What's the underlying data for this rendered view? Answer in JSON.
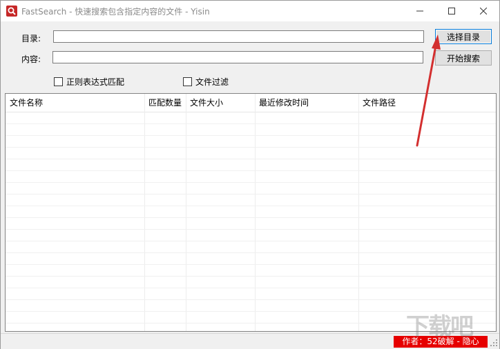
{
  "window": {
    "title": "FastSearch - 快速搜索包含指定内容的文件 - Yisin",
    "app_icon": "search-icon"
  },
  "form": {
    "directory_label": "目录:",
    "directory_value": "",
    "content_label": "内容:",
    "content_value": "",
    "choose_dir_button": "选择目录",
    "start_search_button": "开始搜索",
    "regex_checkbox": "正则表达式匹配",
    "regex_checked": false,
    "file_filter_checkbox": "文件过滤",
    "file_filter_checked": false
  },
  "results": {
    "columns": [
      "文件名称",
      "匹配数量",
      "文件大小",
      "最近修改时间",
      "文件路径"
    ],
    "rows": []
  },
  "status": {
    "author": "作者：52破解 - 隐心"
  },
  "overlay": {
    "watermark": "下载吧",
    "annotation_color": "#d32f2f"
  }
}
